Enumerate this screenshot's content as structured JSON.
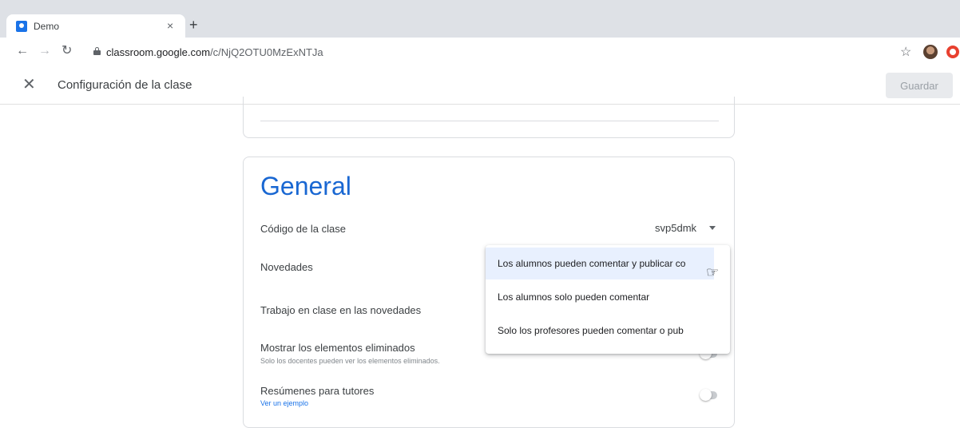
{
  "browser": {
    "tab_title": "Demo",
    "tab_close": "×",
    "new_tab": "+",
    "url_host": "classroom.google.com",
    "url_path": "/c/NjQ2OTU0MzExNTJa"
  },
  "header": {
    "title": "Configuración de la clase",
    "save_label": "Guardar"
  },
  "section": {
    "title": "General",
    "rows": {
      "class_code": {
        "label": "Código de la clase",
        "value": "svp5dmk"
      },
      "stream": {
        "label": "Novedades"
      },
      "classwork_stream": {
        "label": "Trabajo en clase en las novedades"
      },
      "deleted_items": {
        "label": "Mostrar los elementos eliminados",
        "description": "Solo los docentes pueden ver los elementos eliminados."
      },
      "guardian_summaries": {
        "label": "Resúmenes para tutores",
        "link": "Ver un ejemplo"
      }
    }
  },
  "menu": {
    "options": [
      "Los alumnos pueden comentar y publicar co",
      "Los alumnos solo pueden comentar",
      "Solo los profesores pueden comentar o pub"
    ]
  },
  "colors": {
    "accent": "#1967d2",
    "link": "#1a73e8",
    "menu_highlight": "#e8f0fe"
  }
}
